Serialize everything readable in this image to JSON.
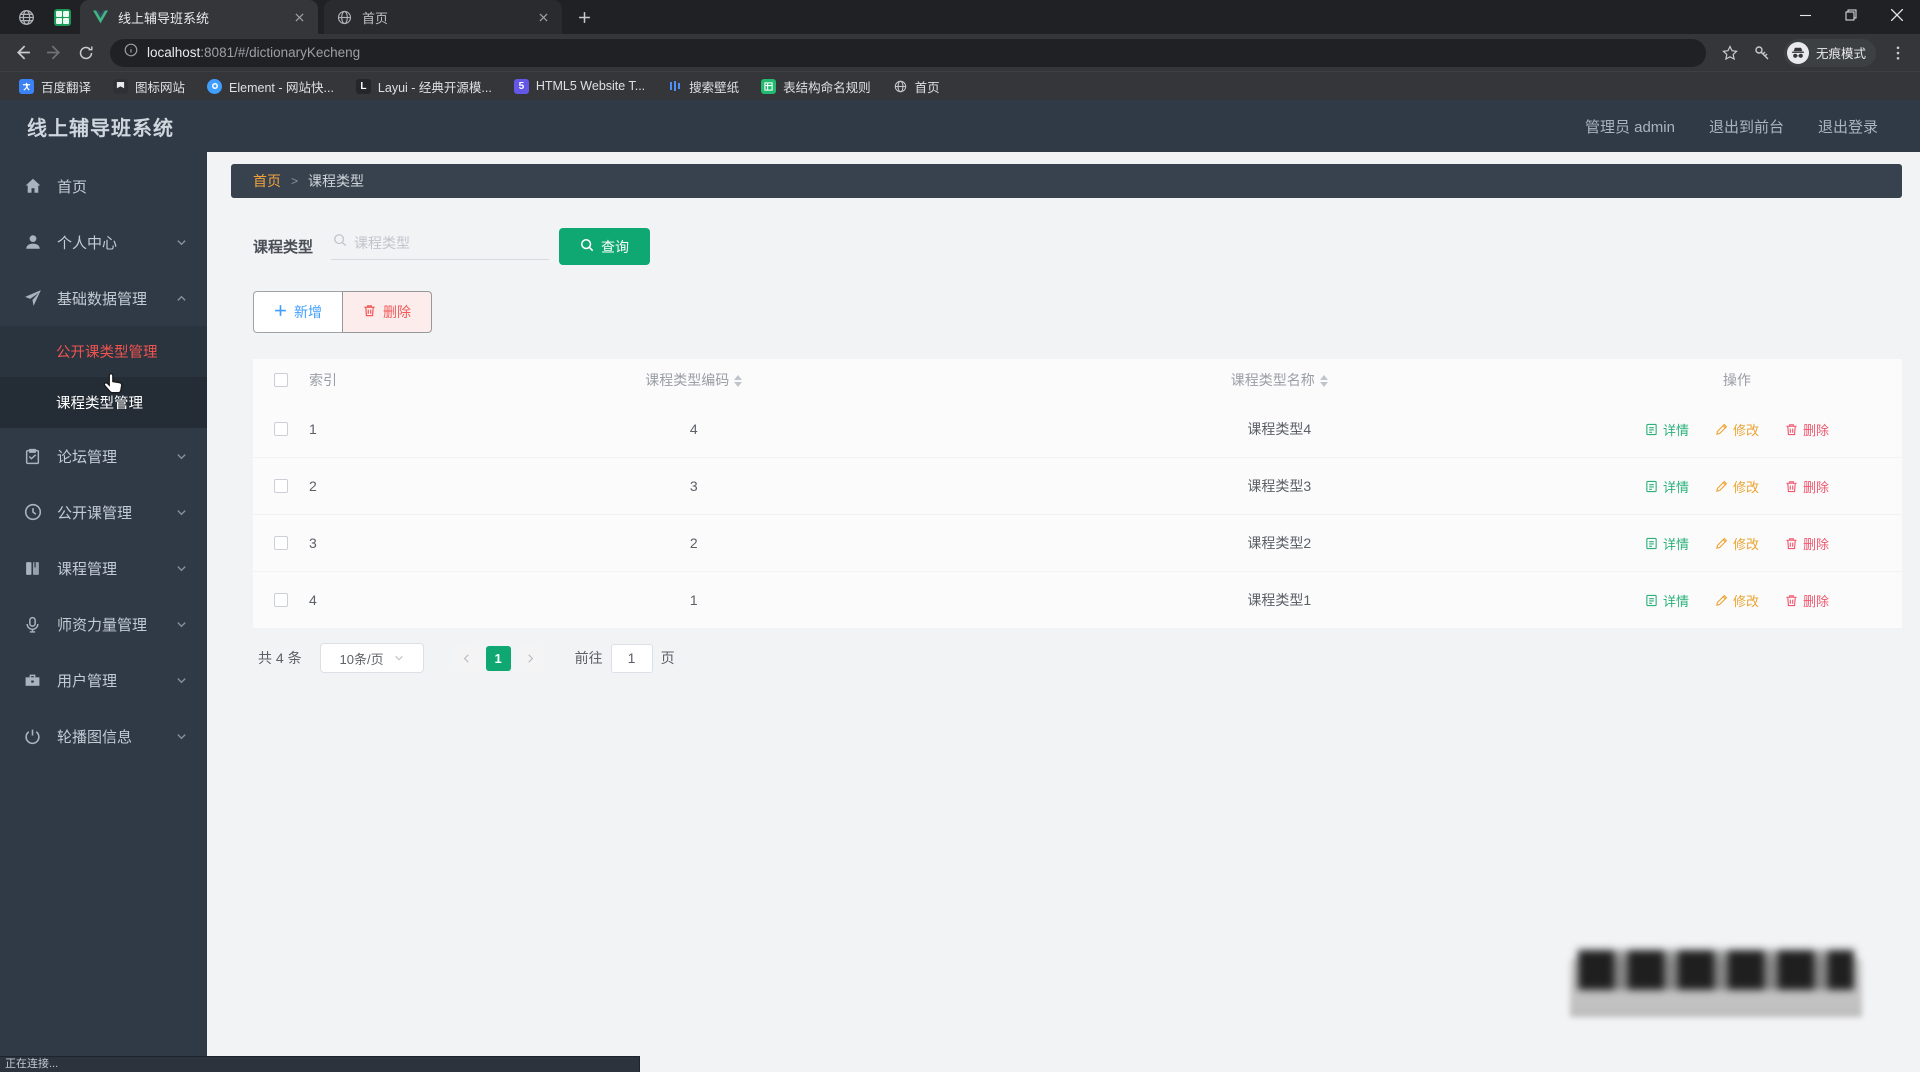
{
  "browser": {
    "tabs": [
      {
        "title": "线上辅导班系统"
      },
      {
        "title": "首页"
      }
    ],
    "url_host": "localhost",
    "url_rest": ":8081/#/dictionaryKecheng",
    "incognito_label": "无痕模式",
    "bookmarks": [
      {
        "label": "百度翻译"
      },
      {
        "label": "图标网站"
      },
      {
        "label": "Element - 网站快..."
      },
      {
        "label": "Layui - 经典开源模..."
      },
      {
        "label": "HTML5 Website T..."
      },
      {
        "label": "搜索壁纸"
      },
      {
        "label": "表结构命名规则"
      },
      {
        "label": "首页"
      }
    ]
  },
  "header": {
    "title": "线上辅导班系统",
    "user": "管理员 admin",
    "exit_front": "退出到前台",
    "logout": "退出登录"
  },
  "sidebar": {
    "items": [
      {
        "label": "首页"
      },
      {
        "label": "个人中心"
      },
      {
        "label": "基础数据管理"
      },
      {
        "label": "论坛管理"
      },
      {
        "label": "公开课管理"
      },
      {
        "label": "课程管理"
      },
      {
        "label": "师资力量管理"
      },
      {
        "label": "用户管理"
      },
      {
        "label": "轮播图信息"
      }
    ],
    "submenu": [
      {
        "label": "公开课类型管理"
      },
      {
        "label": "课程类型管理"
      }
    ]
  },
  "breadcrumb": {
    "home": "首页",
    "sep": ">",
    "current": "课程类型"
  },
  "search": {
    "label": "课程类型",
    "placeholder": "课程类型",
    "button": "查询"
  },
  "toolbar": {
    "add": "新增",
    "delete": "删除"
  },
  "table": {
    "headers": {
      "index": "索引",
      "code": "课程类型编码",
      "name": "课程类型名称",
      "actions": "操作"
    },
    "rows": [
      {
        "index": "1",
        "code": "4",
        "name": "课程类型4"
      },
      {
        "index": "2",
        "code": "3",
        "name": "课程类型3"
      },
      {
        "index": "3",
        "code": "2",
        "name": "课程类型2"
      },
      {
        "index": "4",
        "code": "1",
        "name": "课程类型1"
      }
    ],
    "actions": {
      "detail": "详情",
      "edit": "修改",
      "delete": "删除"
    }
  },
  "pagination": {
    "total": "共 4 条",
    "page_size": "10条/页",
    "page": "1",
    "goto": "前往",
    "goto_value": "1",
    "unit": "页"
  },
  "status": {
    "text": "正在连接..."
  },
  "colors": {
    "accent_green": "#0fa872",
    "link_blue": "#409eff",
    "danger_red": "#f05a5a",
    "warn_orange": "#eca431",
    "breadcrumb_home": "#f2a33c"
  }
}
